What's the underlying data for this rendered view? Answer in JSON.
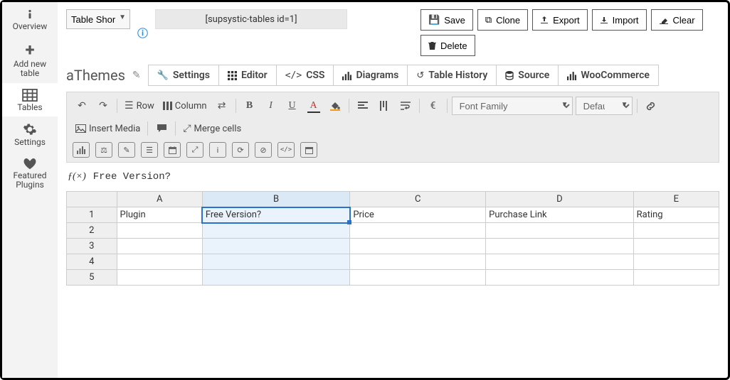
{
  "sidebar": {
    "items": [
      {
        "label": "Overview"
      },
      {
        "label": "Add new table"
      },
      {
        "label": "Tables"
      },
      {
        "label": "Settings"
      },
      {
        "label": "Featured Plugins"
      }
    ]
  },
  "top": {
    "dropdown_value": "Table Shortcode",
    "shortcode": "[supsystic-tables id=1]",
    "buttons": {
      "save": "Save",
      "clone": "Clone",
      "export": "Export",
      "import": "Import",
      "clear": "Clear",
      "delete": "Delete"
    }
  },
  "table_title": "aThemes",
  "tabs": {
    "settings": "Settings",
    "editor": "Editor",
    "css": "CSS",
    "diagrams": "Diagrams",
    "history": "Table History",
    "source": "Source",
    "woo": "WooCommerce"
  },
  "toolbar": {
    "row": "Row",
    "column": "Column",
    "font_family_placeholder": "Font Family",
    "font_size_default": "Default",
    "insert_media": "Insert Media",
    "merge_cells": "Merge cells",
    "euro": "€"
  },
  "formula": {
    "label": "ƒ(×)",
    "value": "Free Version?"
  },
  "sheet": {
    "columns": [
      "A",
      "B",
      "C",
      "D",
      "E"
    ],
    "rows": [
      "1",
      "2",
      "3",
      "4",
      "5"
    ],
    "selected_column_index": 1,
    "active_cell": {
      "row": 0,
      "col": 1
    },
    "data": [
      [
        "Plugin",
        "Free Version?",
        "Price",
        "Purchase Link",
        "Rating"
      ],
      [
        "",
        "",
        "",
        "",
        ""
      ],
      [
        "",
        "",
        "",
        "",
        ""
      ],
      [
        "",
        "",
        "",
        "",
        ""
      ],
      [
        "",
        "",
        "",
        "",
        ""
      ]
    ]
  }
}
